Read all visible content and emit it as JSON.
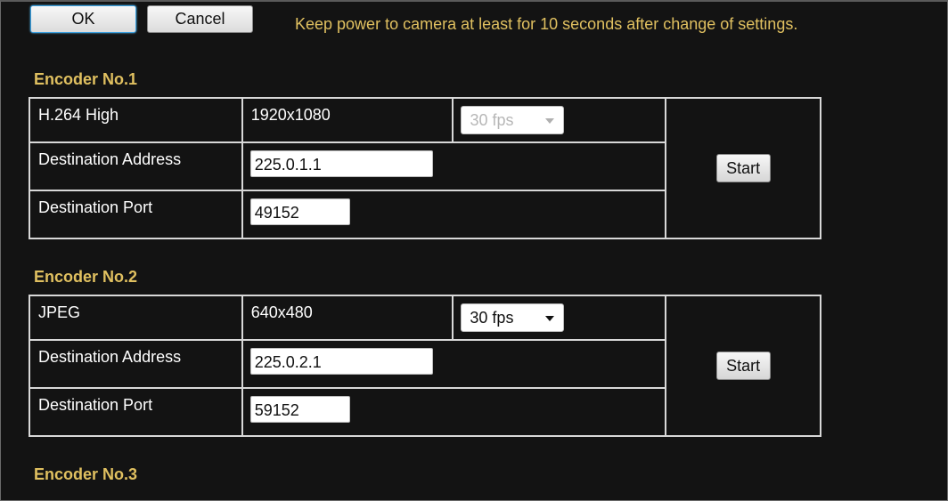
{
  "toolbar": {
    "ok_label": "OK",
    "cancel_label": "Cancel",
    "notice": "Keep power to camera at least for 10 seconds after change of settings."
  },
  "encoders": [
    {
      "title": "Encoder No.1",
      "codec": "H.264 High",
      "resolution": "1920x1080",
      "frame_rate": "30 fps",
      "frame_rate_enabled": false,
      "address_label": "Destination Address",
      "address": "225.0.1.1",
      "port_label": "Destination Port",
      "port": "49152",
      "start_label": "Start"
    },
    {
      "title": "Encoder No.2",
      "codec": "JPEG",
      "resolution": "640x480",
      "frame_rate": "30 fps",
      "frame_rate_enabled": true,
      "address_label": "Destination Address",
      "address": "225.0.2.1",
      "port_label": "Destination Port",
      "port": "59152",
      "start_label": "Start"
    },
    {
      "title": "Encoder No.3"
    }
  ],
  "colors": {
    "background": "#131313",
    "accent_text": "#e0c060",
    "focus_border": "#3aa0e0"
  }
}
